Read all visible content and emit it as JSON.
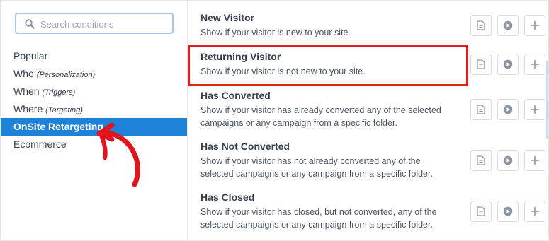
{
  "search": {
    "placeholder": "Search conditions",
    "value": ""
  },
  "categories": [
    {
      "label": "Popular",
      "sub": ""
    },
    {
      "label": "Who",
      "sub": "(Personalization)"
    },
    {
      "label": "When",
      "sub": "(Triggers)"
    },
    {
      "label": "Where",
      "sub": "(Targeting)"
    },
    {
      "label": "OnSite Retargeting",
      "sub": "",
      "active": true
    },
    {
      "label": "Ecommerce",
      "sub": ""
    }
  ],
  "conditions": [
    {
      "title": "New Visitor",
      "description": "Show if your visitor is new to your site."
    },
    {
      "title": "Returning Visitor",
      "description": "Show if your visitor is not new to your site.",
      "highlighted": true
    },
    {
      "title": "Has Converted",
      "description": "Show if your visitor has already converted any of the selected campaigns or any campaign from a specific folder."
    },
    {
      "title": "Has Not Converted",
      "description": "Show if your visitor has not already converted any of the selected campaigns or any campaign from a specific folder."
    },
    {
      "title": "Has Closed",
      "description": "Show if your visitor has closed, but not converted, any of the selected campaigns or any campaign from a specific folder."
    }
  ],
  "condition_actions": [
    "document-icon",
    "play-icon",
    "plus-icon"
  ],
  "colors": {
    "accent": "#1e82d8",
    "highlight": "#e02020",
    "annotation_arrow": "#e3141b"
  }
}
